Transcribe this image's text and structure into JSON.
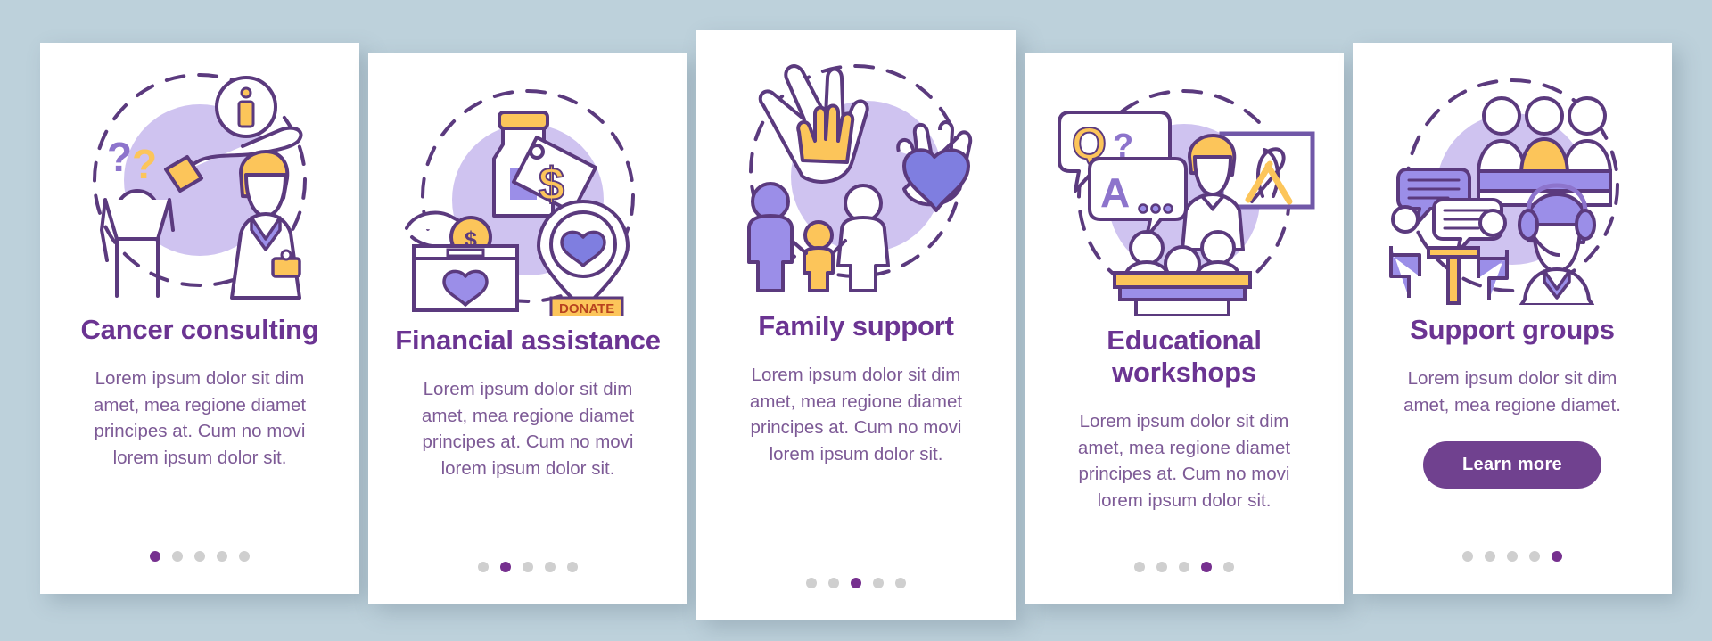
{
  "theme": {
    "background": "#bdd1db",
    "card_background": "#ffffff",
    "title_color": "#6b3492",
    "body_color": "#7d5a96",
    "accent_purple": "#70418f",
    "dot_inactive": "#cfcfcf",
    "dot_active": "#76308f",
    "illo_blob": "#cfc3f0",
    "illo_outline": "#5b3a7e",
    "illo_yellow": "#fcc55a",
    "illo_blue": "#7f7ee0"
  },
  "screens": [
    {
      "id": "cancer-consulting",
      "illustration": "consulting-illustration",
      "title": "Cancer consulting",
      "body": "Lorem ipsum dolor sit dim amet, mea regione diamet principes at. Cum no movi lorem ipsum dolor sit.",
      "has_button": false,
      "button_label": "",
      "dots": {
        "count": 5,
        "active_index": 0
      }
    },
    {
      "id": "financial-assistance",
      "illustration": "donation-illustration",
      "title": "Financial assistance",
      "body": "Lorem ipsum dolor sit dim amet, mea regione diamet principes at. Cum no movi lorem ipsum dolor sit.",
      "has_button": false,
      "button_label": "",
      "dots": {
        "count": 5,
        "active_index": 1
      }
    },
    {
      "id": "family-support",
      "illustration": "family-illustration",
      "title": "Family support",
      "body": "Lorem ipsum dolor sit dim amet, mea regione diamet principes at. Cum no movi lorem ipsum dolor sit.",
      "has_button": false,
      "button_label": "",
      "dots": {
        "count": 5,
        "active_index": 2
      }
    },
    {
      "id": "educational-workshops",
      "illustration": "workshop-illustration",
      "title": "Educational workshops",
      "body": "Lorem ipsum dolor sit dim amet, mea regione diamet principes at. Cum no movi lorem ipsum dolor sit.",
      "has_button": false,
      "button_label": "",
      "dots": {
        "count": 5,
        "active_index": 3
      }
    },
    {
      "id": "support-groups",
      "illustration": "support-group-illustration",
      "title": "Support groups",
      "body": "Lorem ipsum dolor sit dim amet, mea regione diamet.",
      "has_button": true,
      "button_label": "Learn more",
      "dots": {
        "count": 5,
        "active_index": 4
      }
    }
  ],
  "illustration_labels": {
    "donate_tag": "DONATE",
    "info_symbol": "i",
    "question_symbol": "?",
    "q_symbol": "Q",
    "a_symbol": "A",
    "dollar_symbol": "$"
  }
}
